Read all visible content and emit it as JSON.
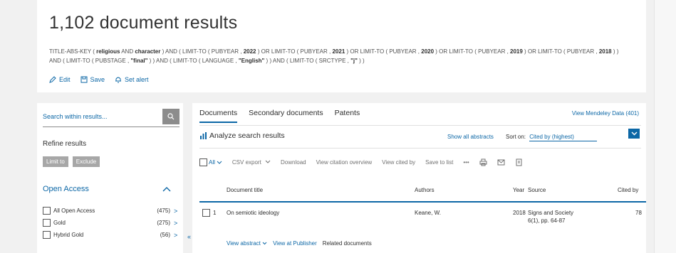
{
  "header": {
    "title": "1,102 document results",
    "query_segments": [
      {
        "t": "TITLE-ABS-KEY ( "
      },
      {
        "t": "religious",
        "b": true
      },
      {
        "t": " AND "
      },
      {
        "t": "character",
        "b": true
      },
      {
        "t": " ) AND ( LIMIT-TO ( PUBYEAR , "
      },
      {
        "t": "2022",
        "b": true
      },
      {
        "t": " ) OR LIMIT-TO ( PUBYEAR , "
      },
      {
        "t": "2021",
        "b": true
      },
      {
        "t": " ) OR LIMIT-TO ( PUBYEAR , "
      },
      {
        "t": "2020",
        "b": true
      },
      {
        "t": " ) OR LIMIT-TO ( PUBYEAR , "
      },
      {
        "t": "2019",
        "b": true
      },
      {
        "t": " ) OR LIMIT-TO ( PUBYEAR , "
      },
      {
        "t": "2018",
        "b": true
      },
      {
        "t": " ) ) AND ( LIMIT-TO ( PUBSTAGE , "
      },
      {
        "t": "\"final\"",
        "b": true
      },
      {
        "t": " ) ) AND ( LIMIT-TO ( LANGUAGE , "
      },
      {
        "t": "\"English\"",
        "b": true
      },
      {
        "t": " ) ) AND ( LIMIT-TO ( SRCTYPE , "
      },
      {
        "t": "\"j\"",
        "b": true
      },
      {
        "t": " ) )"
      }
    ],
    "actions": {
      "edit": "Edit",
      "save": "Save",
      "set_alert": "Set alert"
    }
  },
  "sidebar": {
    "search_placeholder": "Search within results...",
    "refine_title": "Refine results",
    "limit_to": "Limit to",
    "exclude": "Exclude",
    "open_access": {
      "title": "Open Access",
      "items": [
        {
          "label": "All Open Access",
          "count": "(475)"
        },
        {
          "label": "Gold",
          "count": "(275)"
        },
        {
          "label": "Hybrid Gold",
          "count": "(56)"
        }
      ]
    }
  },
  "main": {
    "tabs": [
      "Documents",
      "Secondary documents",
      "Patents"
    ],
    "mendeley": "View Mendeley Data (401)",
    "analyze": "Analyze search results",
    "show_all_abstracts": "Show all abstracts",
    "sort_label": "Sort on:",
    "sort_value": "Cited by (highest)",
    "toolbar": {
      "all": "All",
      "csv_export": "CSV export",
      "download": "Download",
      "view_citation_overview": "View citation overview",
      "view_cited_by": "View cited by",
      "save_to_list": "Save to list",
      "more": "•••"
    },
    "columns": {
      "title": "Document title",
      "authors": "Authors",
      "year": "Year",
      "source": "Source",
      "cited_by": "Cited by"
    },
    "rows": [
      {
        "index": "1",
        "title": "On semiotic ideology",
        "authors": "Keane, W.",
        "year": "2018",
        "source_line1": "Signs and Society",
        "source_line2": "6(1), pp. 64-87",
        "cited_by": "78",
        "view_abstract": "View abstract",
        "view_publisher": "View at Publisher",
        "related": "Related documents"
      }
    ]
  },
  "colors": {
    "link": "#0c67a6",
    "accent": "#0c67a6",
    "text": "#2e2e2e",
    "grey_button": "#a7a7a7"
  }
}
